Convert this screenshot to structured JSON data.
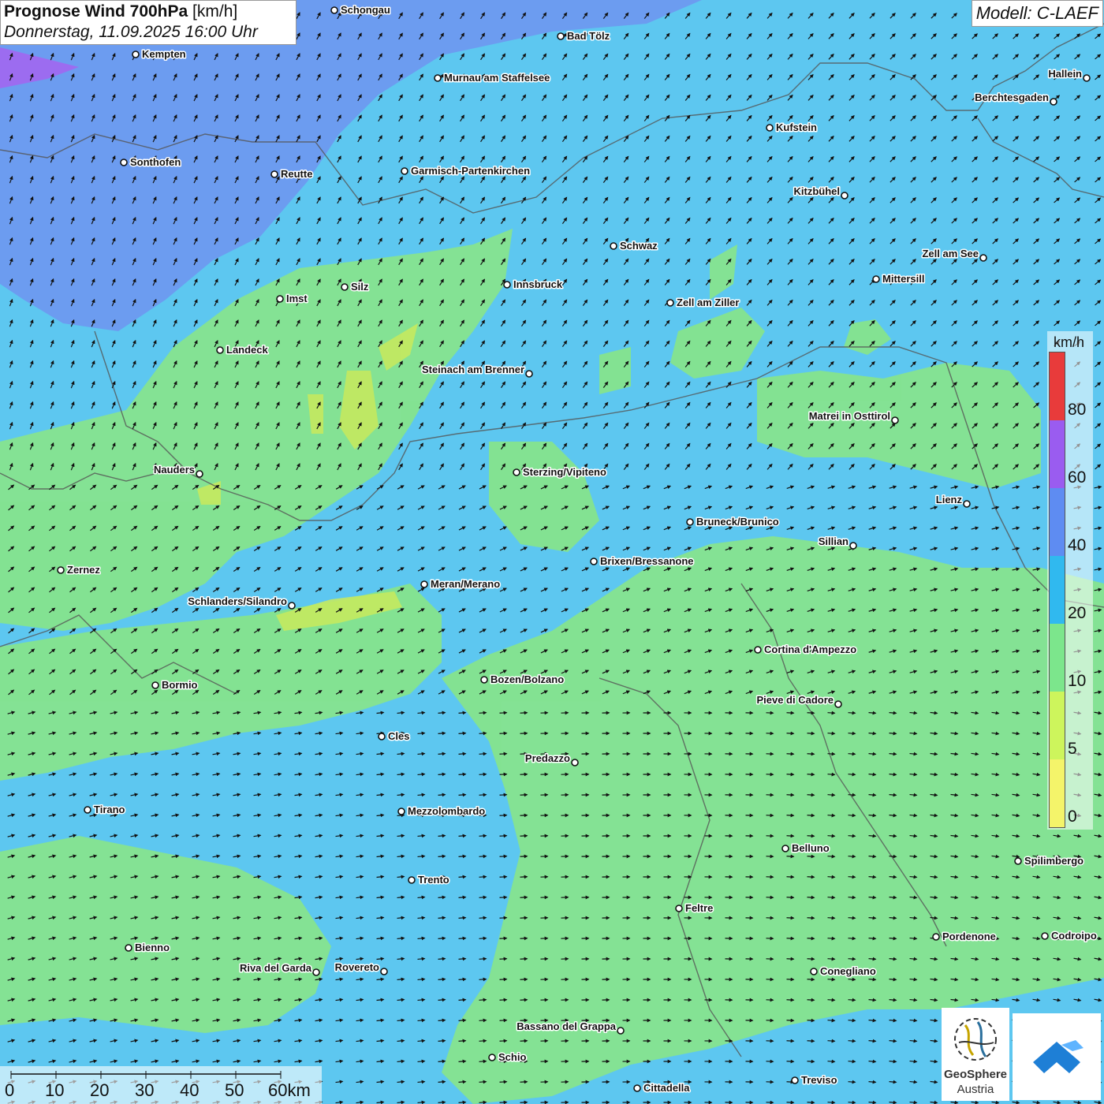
{
  "title": {
    "main": "Prognose Wind 700hPa",
    "unit": "[km/h]",
    "datetime": "Donnerstag, 11.09.2025 16:00 Uhr"
  },
  "model_label": "Modell: C-LAEF",
  "legend": {
    "unit": "km/h",
    "labels": [
      "80",
      "60",
      "40",
      "20",
      "10",
      "5",
      "0"
    ],
    "colors": [
      "#e83b3b",
      "#9a5cf0",
      "#5e8cf2",
      "#30b9ef",
      "#7ce68c",
      "#cdf55c",
      "#f4f46a"
    ]
  },
  "scale_bar": {
    "labels": [
      "0",
      "10",
      "20",
      "30",
      "40",
      "50",
      "60km"
    ]
  },
  "logos": {
    "geosphere_line1": "GeoSphere",
    "geosphere_line2": "Austria",
    "blue_icon": "flag-mountain-icon"
  },
  "cities": [
    {
      "name": "Schongau"
    },
    {
      "name": "Bad Tölz"
    },
    {
      "name": "Kempten"
    },
    {
      "name": "Murnau am Staffelsee"
    },
    {
      "name": "Hallein"
    },
    {
      "name": "Berchtesgaden"
    },
    {
      "name": "Kufstein"
    },
    {
      "name": "Sonthofen"
    },
    {
      "name": "Reutte"
    },
    {
      "name": "Garmisch-Partenkirchen"
    },
    {
      "name": "Kitzbühel"
    },
    {
      "name": "Schwaz"
    },
    {
      "name": "Zell am See"
    },
    {
      "name": "Mittersill"
    },
    {
      "name": "Imst"
    },
    {
      "name": "Silz"
    },
    {
      "name": "Innsbruck"
    },
    {
      "name": "Zell am Ziller"
    },
    {
      "name": "Landeck"
    },
    {
      "name": "Steinach am Brenner"
    },
    {
      "name": "Matrei in Osttirol"
    },
    {
      "name": "Nauders"
    },
    {
      "name": "Sterzing/Vipiteno"
    },
    {
      "name": "Lienz"
    },
    {
      "name": "Bruneck/Brunico"
    },
    {
      "name": "Sillian"
    },
    {
      "name": "Brixen/Bressanone"
    },
    {
      "name": "Zernez"
    },
    {
      "name": "Meran/Merano"
    },
    {
      "name": "Schlanders/Silandro"
    },
    {
      "name": "Cortina d'Ampezzo"
    },
    {
      "name": "Bozen/Bolzano"
    },
    {
      "name": "Bormio"
    },
    {
      "name": "Pieve di Cadore"
    },
    {
      "name": "Cles"
    },
    {
      "name": "Predazzo"
    },
    {
      "name": "Tirano"
    },
    {
      "name": "Mezzolombardo"
    },
    {
      "name": "Belluno"
    },
    {
      "name": "Spilimbergo"
    },
    {
      "name": "Trento"
    },
    {
      "name": "Feltre"
    },
    {
      "name": "Pordenone"
    },
    {
      "name": "Codroipo"
    },
    {
      "name": "Bienno"
    },
    {
      "name": "Riva del Garda"
    },
    {
      "name": "Rovereto"
    },
    {
      "name": "Conegliano"
    },
    {
      "name": "Bassano del Grappa"
    },
    {
      "name": "Schio"
    },
    {
      "name": "Treviso"
    },
    {
      "name": "Cittadella"
    }
  ]
}
